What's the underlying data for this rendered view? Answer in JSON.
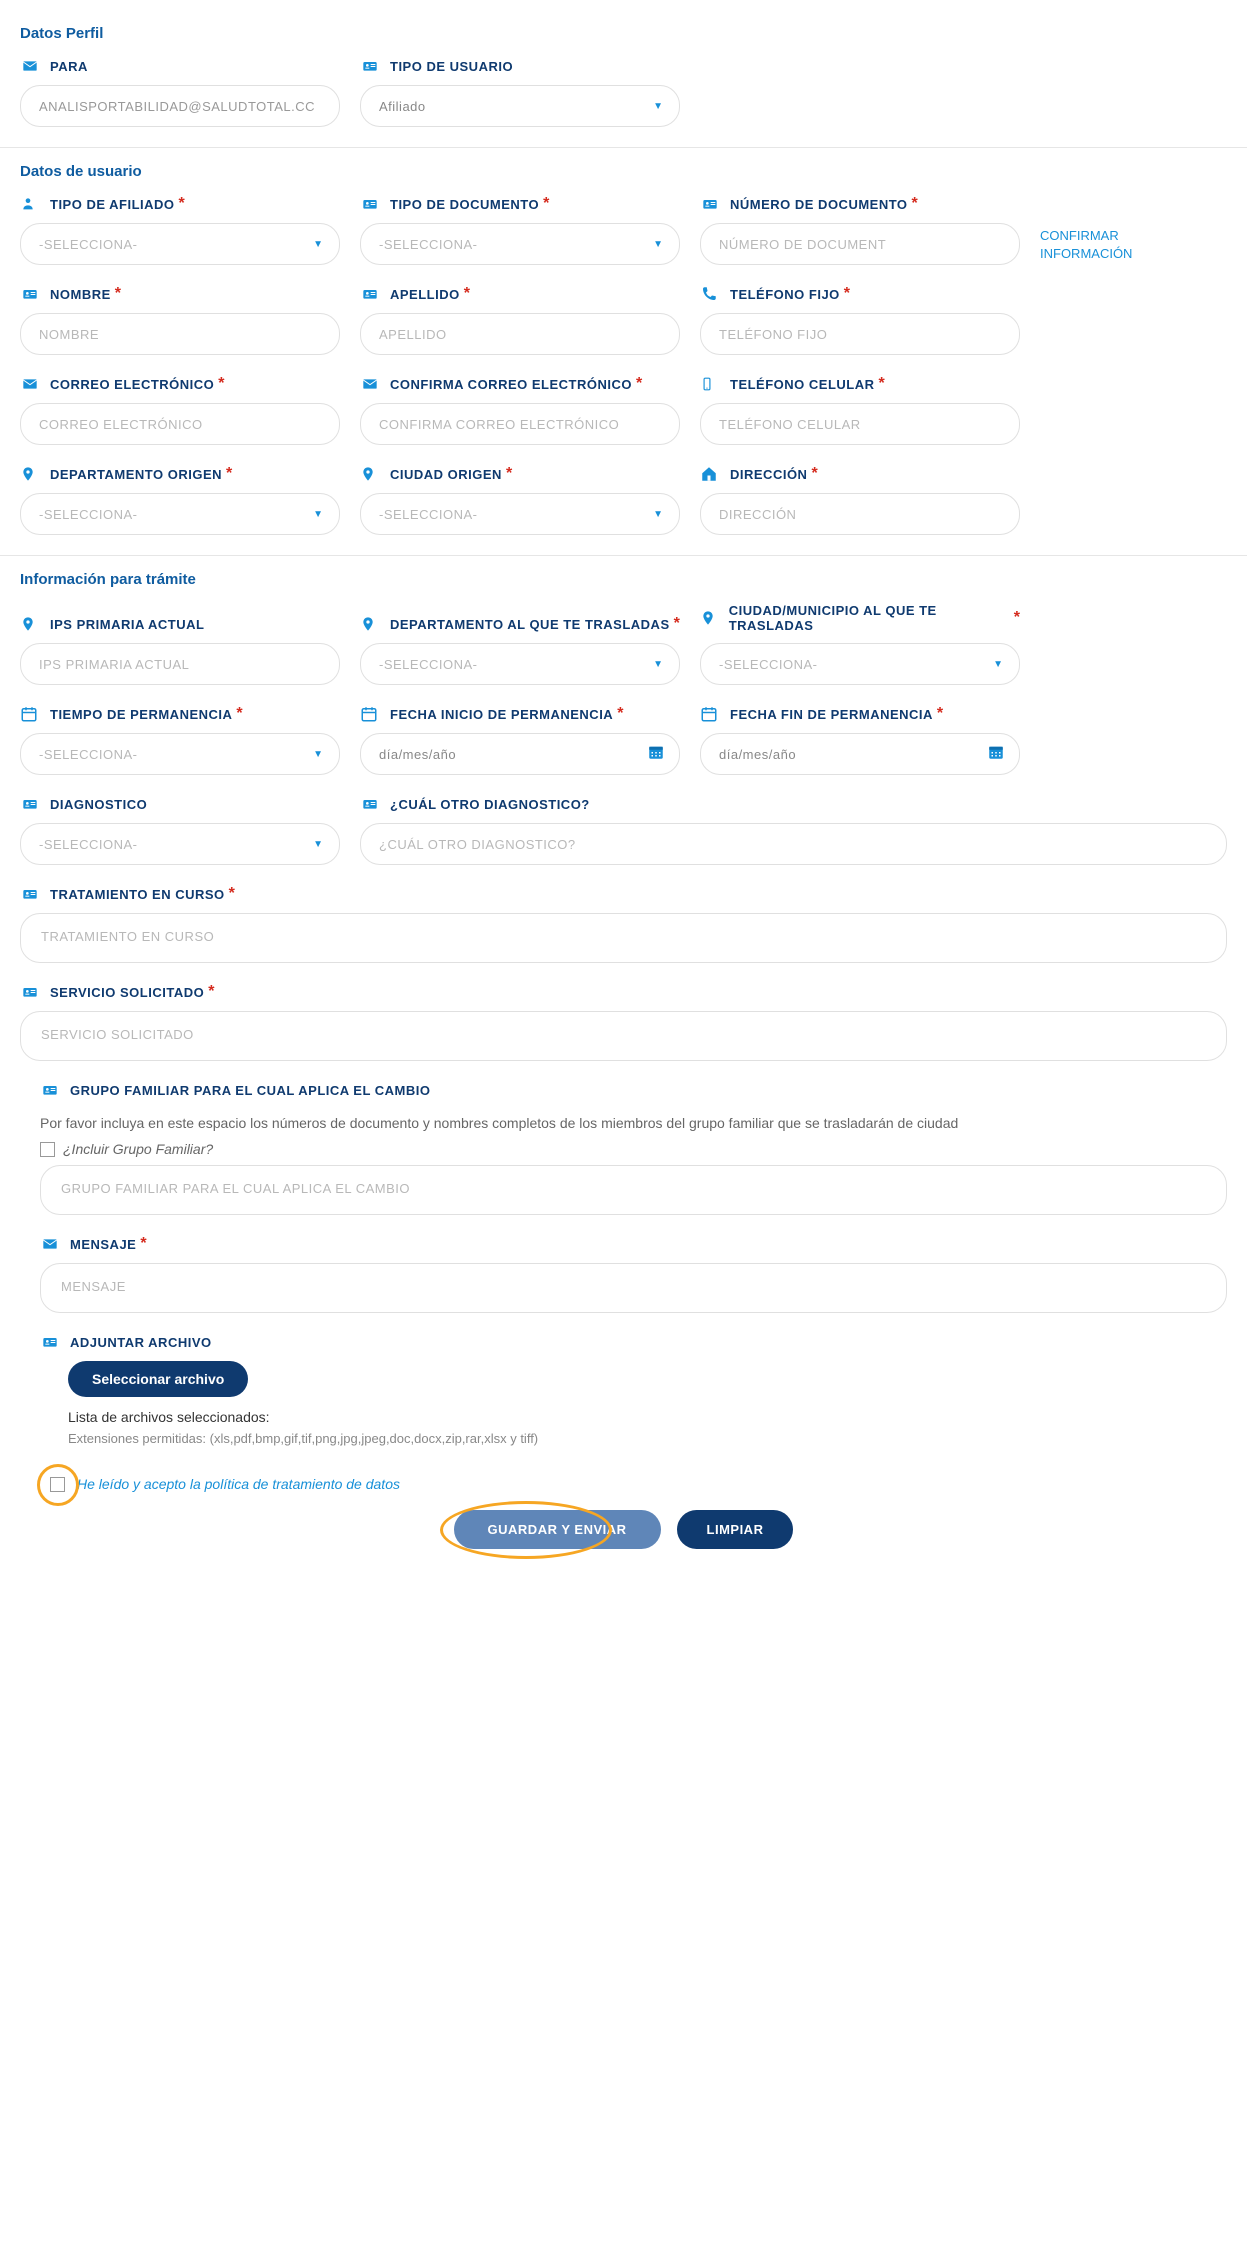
{
  "section_profile": "Datos Perfil",
  "para_label": "PARA",
  "para_value": "ANALISPORTABILIDAD@SALUDTOTAL.CC",
  "tipo_usuario_label": "TIPO DE USUARIO",
  "tipo_usuario_value": "Afiliado",
  "section_usuario": "Datos de usuario",
  "tipo_afiliado_label": "TIPO DE AFILIADO",
  "tipo_doc_label": "TIPO DE DOCUMENTO",
  "num_doc_label": "NÚMERO DE DOCUMENTO",
  "num_doc_ph": "NÚMERO DE DOCUMENT",
  "selecciona": "-SELECCIONA-",
  "confirmar_info": "CONFIRMAR INFORMACIÓN",
  "nombre_label": "NOMBRE",
  "nombre_ph": "NOMBRE",
  "apellido_label": "APELLIDO",
  "apellido_ph": "APELLIDO",
  "tel_fijo_label": "TELÉFONO FIJO",
  "tel_fijo_ph": "TELÉFONO FIJO",
  "correo_label": "CORREO ELECTRÓNICO",
  "correo_ph": "CORREO ELECTRÓNICO",
  "conf_correo_label": "CONFIRMA CORREO ELECTRÓNICO",
  "conf_correo_ph": "CONFIRMA CORREO ELECTRÓNICO",
  "tel_cel_label": "TELÉFONO CELULAR",
  "tel_cel_ph": "TELÉFONO CELULAR",
  "dep_origen_label": "DEPARTAMENTO ORIGEN",
  "ciudad_origen_label": "CIUDAD ORIGEN",
  "direccion_label": "DIRECCIÓN",
  "direccion_ph": "DIRECCIÓN",
  "section_tramite": "Información para trámite",
  "ips_label": "IPS PRIMARIA ACTUAL",
  "ips_ph": "IPS PRIMARIA ACTUAL",
  "dep_dest_label": "DEPARTAMENTO AL QUE TE TRASLADAS",
  "ciudad_dest_label": "CIUDAD/MUNICIPIO AL QUE TE TRASLADAS",
  "tiempo_perm_label": "TIEMPO DE PERMANENCIA",
  "fecha_inicio_label": "FECHA INICIO DE PERMANENCIA",
  "fecha_fin_label": "FECHA FIN DE PERMANENCIA",
  "fecha_ph": "día/mes/año",
  "diag_label": "DIAGNOSTICO",
  "otro_diag_label": "¿CUÁL OTRO DIAGNOSTICO?",
  "otro_diag_ph": "¿CUÁL OTRO DIAGNOSTICO?",
  "tratamiento_label": "TRATAMIENTO EN CURSO",
  "tratamiento_ph": "TRATAMIENTO EN CURSO",
  "servicio_label": "SERVICIO SOLICITADO",
  "servicio_ph": "SERVICIO SOLICITADO",
  "grupo_label": "GRUPO FAMILIAR PARA EL CUAL APLICA EL CAMBIO",
  "grupo_helper": "Por favor incluya en este espacio los números de documento y nombres completos de los miembros del grupo familiar que se trasladarán de ciudad",
  "incluir_grupo": "¿Incluir Grupo Familiar?",
  "grupo_ph": "GRUPO FAMILIAR PARA EL CUAL APLICA EL CAMBIO",
  "mensaje_label": "MENSAJE",
  "mensaje_ph": "MENSAJE",
  "adjuntar_label": "ADJUNTAR ARCHIVO",
  "seleccionar_archivo": "Seleccionar archivo",
  "lista_archivos": "Lista de archivos seleccionados:",
  "ext_permitidas": "Extensiones permitidas: (xls,pdf,bmp,gif,tif,png,jpg,jpeg,doc,docx,zip,rar,xlsx y tiff)",
  "terms_text": "He leído y acepto la política de tratamiento de datos",
  "btn_guardar": "GUARDAR Y ENVIAR",
  "btn_limpiar": "LIMPIAR"
}
